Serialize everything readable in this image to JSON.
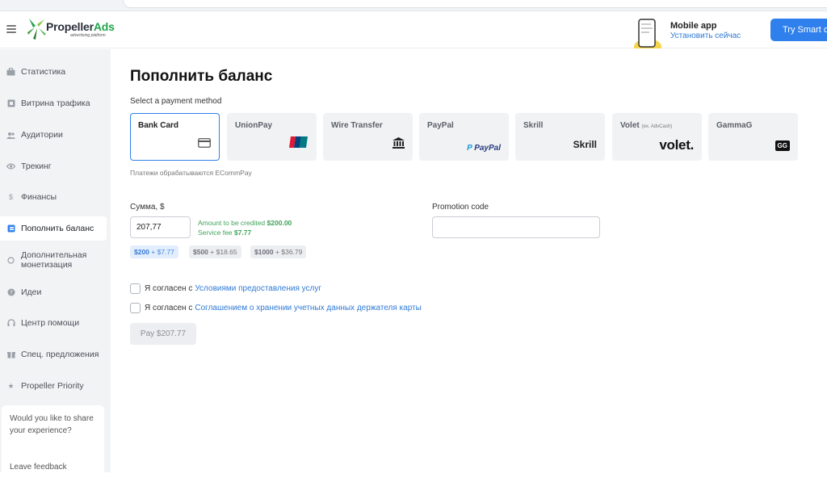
{
  "browser": {
    "url_fragment": ""
  },
  "header": {
    "logo_name": "PropellerAds",
    "logo_name_part1": "Propeller",
    "logo_name_part2": "Ads",
    "logo_tagline": "advertising platform",
    "mobile_title": "Mobile app",
    "mobile_link": "Установить сейчас",
    "try_button": "Try Smart c"
  },
  "sidebar": {
    "items": [
      {
        "label": "Статистика",
        "icon": "briefcase-icon"
      },
      {
        "label": "Витрина трафика",
        "icon": "storefront-icon"
      },
      {
        "label": "Аудитории",
        "icon": "users-icon"
      },
      {
        "label": "Трекинг",
        "icon": "eye-icon"
      },
      {
        "label": "Финансы",
        "icon": "dollar-icon"
      },
      {
        "label": "Пополнить баланс",
        "icon": "wallet-icon",
        "active": true
      },
      {
        "label": "Дополнительная монетизация",
        "icon": "monetization-icon"
      },
      {
        "label": "Идеи",
        "icon": "lightbulb-icon"
      },
      {
        "label": "Центр помощи",
        "icon": "headset-icon"
      },
      {
        "label": "Спец. предложения",
        "icon": "gift-icon"
      },
      {
        "label": "Propeller Priority",
        "icon": "star-icon"
      }
    ],
    "feedback": {
      "text": "Would you like to share your experience?",
      "link": "Leave feedback"
    }
  },
  "main": {
    "title": "Пополнить баланс",
    "select_label": "Select a payment method",
    "payment_methods": [
      {
        "name": "Bank Card",
        "logo": "card-icon",
        "selected": true
      },
      {
        "name": "UnionPay",
        "logo": "unionpay-logo"
      },
      {
        "name": "Wire Transfer",
        "logo": "bank-icon"
      },
      {
        "name": "PayPal",
        "logo": "paypal-logo",
        "logo_text": "PayPal"
      },
      {
        "name": "Skrill",
        "logo": "skrill-logo",
        "logo_text": "Skrill"
      },
      {
        "name": "Volet",
        "note": "(ex. AdvCash)",
        "logo": "volet-logo",
        "logo_text": "volet."
      },
      {
        "name": "GammaG",
        "logo": "gammag-logo",
        "logo_text": "GG"
      }
    ],
    "processed_by": "Платежи обрабатываются ECommPay",
    "amount": {
      "label": "Сумма, $",
      "value": "207,77",
      "credited_label": "Amount to be credited",
      "credited_value": "$200.00",
      "fee_label": "Service fee",
      "fee_value": "$7.77"
    },
    "promo": {
      "label": "Promotion code",
      "value": ""
    },
    "presets": [
      {
        "amount": "$200",
        "plus": "+",
        "fee": "$7.77",
        "active": true
      },
      {
        "amount": "$500",
        "plus": "+",
        "fee": "$18.65"
      },
      {
        "amount": "$1000",
        "plus": "+",
        "fee": "$36.79"
      }
    ],
    "agreements": [
      {
        "prefix": "Я согласен с",
        "link": "Условиями предоставления услуг"
      },
      {
        "prefix": "Я согласен с",
        "link": "Соглашением о хранении учетных данных держателя карты"
      }
    ],
    "pay_button": "Pay $207.77"
  },
  "colors": {
    "accent": "#2f80ed",
    "green": "#3fa45a",
    "sidebar_bg": "#f2f3f5"
  }
}
